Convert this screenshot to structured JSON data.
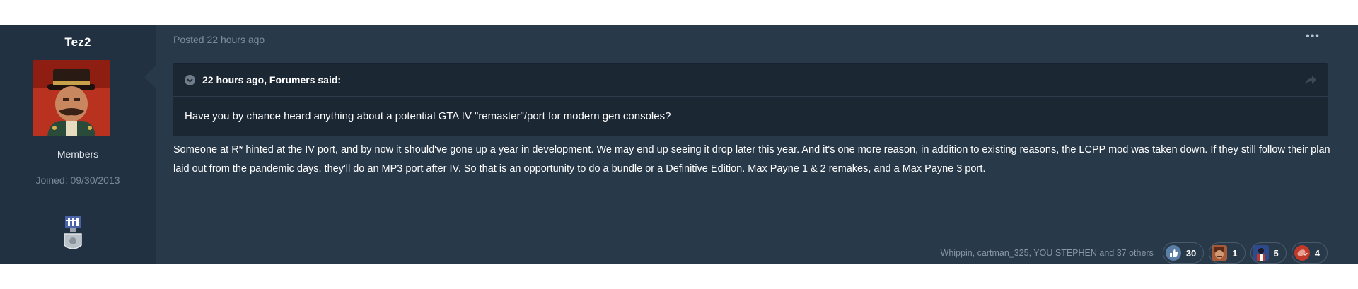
{
  "author": {
    "name": "Tez2",
    "role": "Members",
    "joined": "Joined: 09/30/2013"
  },
  "post": {
    "posted": "Posted 22 hours ago",
    "more_label": "•••",
    "quote": {
      "author_line": "22 hours ago, Forumers said:",
      "text": "Have you by chance heard anything about a potential GTA IV \"remaster\"/port for modern gen consoles?"
    },
    "body": "Someone at R* hinted at the IV port, and by now it should've gone up a year in development. We may end up seeing it drop later this year. And it's one more reason, in addition to existing reasons, the LCPP mod was taken down. If they still follow their plan laid out from the pandemic days, they'll do an MP3 port after IV. So that is an opportunity to do a bundle or a Definitive Edition. Max Payne 1 & 2 remakes, and a Max Payne 3 port."
  },
  "reactions": {
    "names": "Whippin, cartman_325, YOU STEPHEN and 37 others",
    "items": [
      {
        "icon": "thumbs-up-icon",
        "count": "30",
        "color": "#5a7ea6"
      },
      {
        "icon": "face-icon",
        "count": "1",
        "color": "#a55a3a"
      },
      {
        "icon": "character-icon",
        "count": "5",
        "color": "#2f4a8a"
      },
      {
        "icon": "meat-icon",
        "count": "4",
        "color": "#c0392b"
      }
    ]
  },
  "colors": {
    "post_bg": "#28394a",
    "author_bg": "#213142",
    "quote_bg": "#1c2734"
  }
}
